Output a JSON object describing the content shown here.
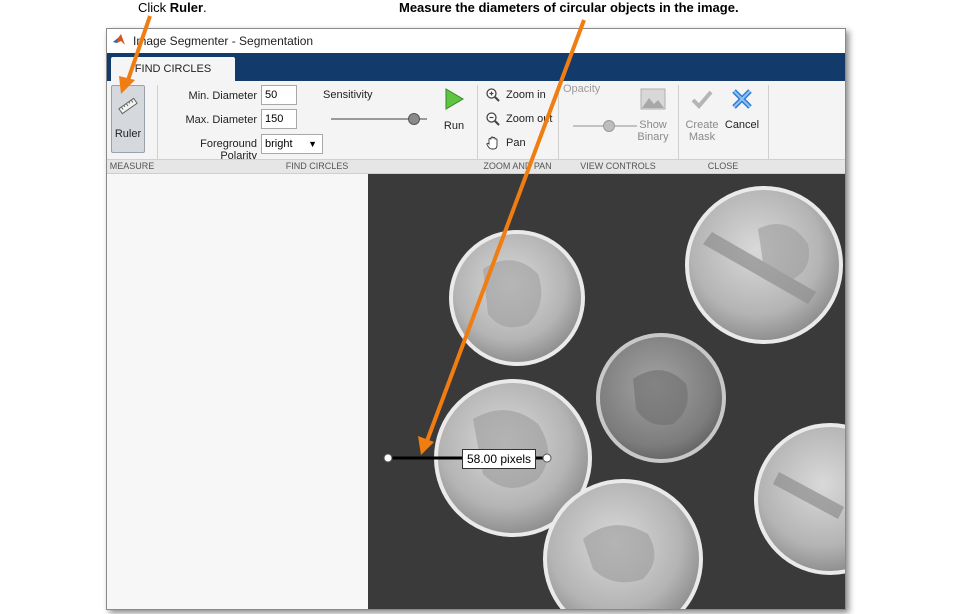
{
  "callouts": {
    "ruler_prefix": "Click ",
    "ruler_bold": "Ruler",
    "ruler_suffix": ".",
    "measure": "Measure the diameters of circular objects in the image."
  },
  "window": {
    "title": "Image Segmenter - Segmentation"
  },
  "tab": {
    "label": "FIND CIRCLES"
  },
  "ribbon": {
    "ruler_label": "Ruler",
    "min_diameter_label": "Min. Diameter",
    "min_diameter_value": "50",
    "max_diameter_label": "Max. Diameter",
    "max_diameter_value": "150",
    "polarity_label": "Foreground Polarity",
    "polarity_value": "bright",
    "sensitivity_label": "Sensitivity",
    "sensitivity_level": 0.85,
    "run_label": "Run",
    "zoom_in_label": "Zoom in",
    "zoom_out_label": "Zoom out",
    "pan_label": "Pan",
    "opacity_label": "Opacity",
    "opacity_level": 0.55,
    "show_binary_line1": "Show",
    "show_binary_line2": "Binary",
    "create_mask_line1": "Create",
    "create_mask_line2": "Mask",
    "cancel_label": "Cancel"
  },
  "sections": {
    "measure": "MEASURE",
    "find_circles": "FIND CIRCLES",
    "zoom_pan": "ZOOM AND PAN",
    "view_controls": "VIEW CONTROLS",
    "close": "CLOSE"
  },
  "measurement": {
    "label": "58.00 pixels"
  },
  "colors": {
    "accent_orange": "#f07d12",
    "tab_strip": "#123a6a",
    "canvas_bg": "#3a3a3a"
  },
  "icons": [
    "matlab-logo-icon",
    "ruler-icon",
    "run-icon",
    "zoom-in-icon",
    "zoom-out-icon",
    "pan-hand-icon",
    "show-binary-icon",
    "create-mask-icon",
    "cancel-icon",
    "dropdown-arrow-icon"
  ]
}
